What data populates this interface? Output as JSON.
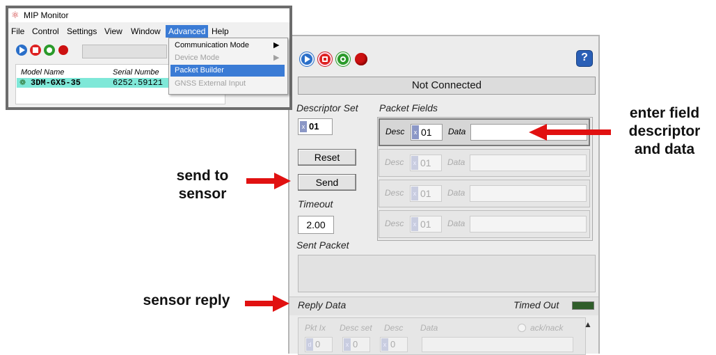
{
  "mip_window": {
    "title": "MIP Monitor",
    "menu": [
      "File",
      "Control",
      "Settings",
      "View",
      "Window",
      "Advanced",
      "Help"
    ],
    "active_menu": "Advanced",
    "table": {
      "headers": [
        "Model Name",
        "Serial Numbe"
      ],
      "row": {
        "model": "3DM-GX5-35",
        "serial": "6252.59121"
      }
    },
    "dropdown": {
      "items": [
        {
          "label": "Communication Mode",
          "enabled": true,
          "submenu": true
        },
        {
          "label": "Device Mode",
          "enabled": false,
          "submenu": true
        },
        {
          "label": "Packet Builder",
          "enabled": true,
          "submenu": false,
          "highlighted": true
        },
        {
          "label": "GNSS External Input",
          "enabled": false,
          "submenu": false
        }
      ]
    }
  },
  "packet_builder": {
    "status": "Not Connected",
    "descriptor_set_label": "Descriptor Set",
    "descriptor_set_value": "01",
    "packet_fields_label": "Packet Fields",
    "desc_label": "Desc",
    "data_label": "Data",
    "x_prefix": "x",
    "rows": [
      {
        "desc": "01",
        "data": ""
      },
      {
        "desc": "01",
        "data": ""
      },
      {
        "desc": "01",
        "data": ""
      },
      {
        "desc": "01",
        "data": ""
      }
    ],
    "reset_label": "Reset",
    "send_label": "Send",
    "timeout_label": "Timeout",
    "timeout_value": "2.00",
    "sent_packet_label": "Sent Packet",
    "reply_data_label": "Reply Data",
    "timed_out_label": "Timed Out",
    "reply_headers": [
      "Pkt Ix",
      "Desc set",
      "Desc",
      "Data",
      "ack/nack"
    ],
    "reply_values": {
      "pkt_prefix": "d",
      "pkt": "0",
      "desc_set": "0",
      "desc": "0"
    }
  },
  "annotations": {
    "enter_field": "enter  field\ndescriptor\nand data",
    "send_to_sensor": "send to\nsensor",
    "sensor_reply": "sensor reply"
  },
  "colors": {
    "play": "#2a6fc9",
    "stop": "#d22",
    "record": "#2a9a2a",
    "reddot": "#cc1111",
    "highlight_row": "#7fe8d8",
    "menu_active": "#3a7bd5",
    "arrow": "#e11111",
    "led": "#2f5d2a"
  }
}
